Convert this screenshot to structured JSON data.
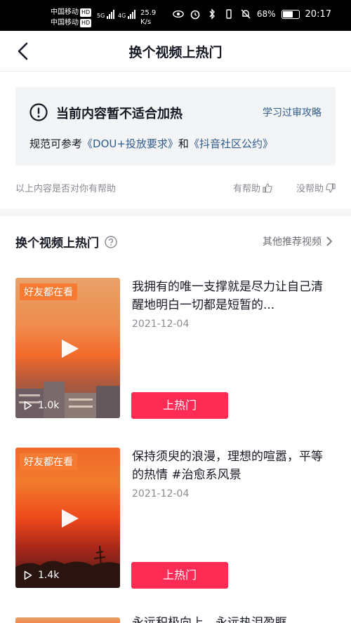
{
  "status_bar": {
    "carrier1": "中国移动",
    "carrier2": "中国移动",
    "hd": "HD",
    "sig1": "5G",
    "sig2": "4G",
    "speed_value": "25.9",
    "speed_unit": "K/s",
    "battery_text": "68%",
    "battery_level": 0.68,
    "time": "20:17"
  },
  "nav": {
    "title": "换个视频上热门"
  },
  "notice": {
    "title": "当前内容暂不适合加热",
    "link": "学习过审攻略",
    "body_prefix": "规范可参考",
    "link1": "《DOU+投放要求》",
    "conj": "和",
    "link2": "《抖音社区公约》"
  },
  "feedback": {
    "question": "以上内容是否对你有帮助",
    "yes": "有帮助",
    "no": "没帮助"
  },
  "section": {
    "title": "换个视频上热门",
    "more": "其他推荐视频"
  },
  "videos": [
    {
      "badge": "好友都在看",
      "plays": "1.0k",
      "title": "我拥有的唯一支撑就是尽力让自己清醒地明白一切都是短暂的...",
      "date": "2021-12-04",
      "button": "上热门"
    },
    {
      "badge": "好友都在看",
      "plays": "1.4k",
      "title": "保持须臾的浪漫，理想的喧嚣，平等的热情 #治愈系风景",
      "date": "2021-12-04",
      "button": "上热门"
    }
  ],
  "partial_card": {
    "text": "永远积极向上，永远热泪盈眶"
  },
  "colors": {
    "accent": "#fe2c55",
    "link": "#2f5b8d",
    "badge": "#f57b33"
  }
}
